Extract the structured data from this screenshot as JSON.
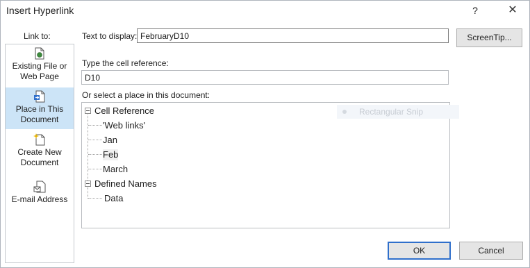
{
  "window": {
    "title": "Insert Hyperlink",
    "help": "?",
    "close": "✕"
  },
  "link_to": {
    "label": "Link to:",
    "items": [
      {
        "line1": "Existing File or",
        "line2": "Web Page",
        "icon": "web-page-icon"
      },
      {
        "line1": "Place in This",
        "line2": "Document",
        "icon": "document-place-icon",
        "selected": true
      },
      {
        "line1": "Create New",
        "line2": "Document",
        "icon": "new-document-icon"
      },
      {
        "line1": "E-mail Address",
        "line2": "",
        "icon": "email-icon"
      }
    ]
  },
  "text_to_display": {
    "label": "Text to display:",
    "value": "FebruaryD10"
  },
  "screentip_button": "ScreenTip...",
  "cell_reference": {
    "label": "Type the cell reference:",
    "value": "D10"
  },
  "place": {
    "label": "Or select a place in this document:",
    "tree": {
      "group1": "Cell Reference",
      "group1_items": [
        "'Web links'",
        "Jan",
        "Feb",
        "March"
      ],
      "group2": "Defined Names",
      "group2_items": [
        "Data"
      ]
    }
  },
  "snip_overlay": "Rectangular Snip",
  "buttons": {
    "ok": "OK",
    "cancel": "Cancel"
  }
}
